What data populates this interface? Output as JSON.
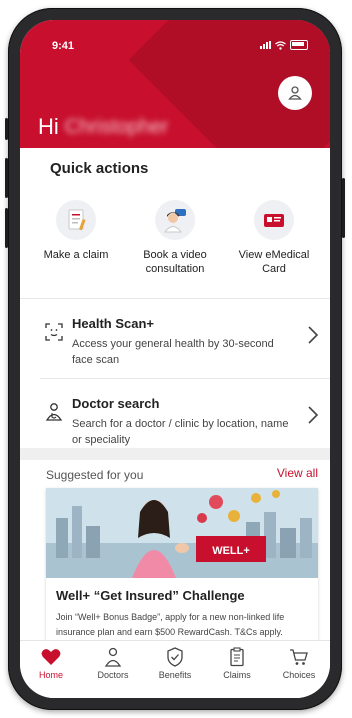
{
  "status": {
    "time": "9:41"
  },
  "header": {
    "greeting": "Hi",
    "name": "Christopher"
  },
  "quick_actions": {
    "title": "Quick actions",
    "items": [
      {
        "label": "Make a claim",
        "icon": "claim-form-icon"
      },
      {
        "label": "Book a video consultation",
        "icon": "doctor-chat-icon"
      },
      {
        "label": "View eMedical Card",
        "icon": "medical-card-icon"
      }
    ]
  },
  "services": [
    {
      "title": "Health Scan+",
      "subtitle": "Access your general health by 30-second face scan",
      "icon": "face-scan-icon"
    },
    {
      "title": "Doctor search",
      "subtitle": "Search for a doctor / clinic by location, name or speciality",
      "icon": "doctor-icon"
    }
  ],
  "suggested": {
    "title": "Suggested for you",
    "view_all": "View all",
    "promo": {
      "title": "Well+ “Get Insured” Challenge",
      "body": "Join “Well+ Bonus Badge”, apply for a new non-linked life insurance plan and earn $500 RewardCash. T&Cs apply.",
      "sign_text": "WELL+"
    }
  },
  "nav": [
    {
      "label": "Home",
      "icon": "heart-icon",
      "active": true
    },
    {
      "label": "Doctors",
      "icon": "doctor-icon",
      "active": false
    },
    {
      "label": "Benefits",
      "icon": "shield-check-icon",
      "active": false
    },
    {
      "label": "Claims",
      "icon": "clipboard-icon",
      "active": false
    },
    {
      "label": "Choices",
      "icon": "cart-icon",
      "active": false
    }
  ],
  "colors": {
    "brand": "#c8102e",
    "background": "#ffffff",
    "band": "#efefef"
  }
}
